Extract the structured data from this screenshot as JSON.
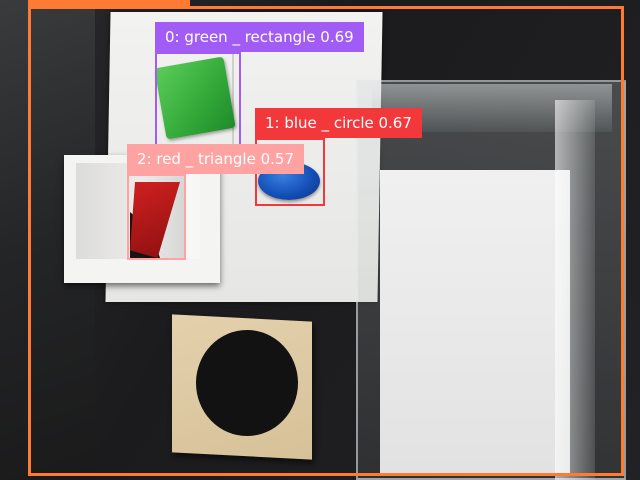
{
  "detections": [
    {
      "id": 0,
      "label_text": "0: green _ rectangle 0.69",
      "color": "#a25cf6",
      "text_color": "#ffffff"
    },
    {
      "id": 1,
      "label_text": "1: blue _ circle 0.67",
      "color": "#f2383b",
      "text_color": "#ffffff"
    },
    {
      "id": 2,
      "label_text": "2: red _ triangle 0.57",
      "color": "#fea3a2",
      "text_color": "#ffffff"
    }
  ],
  "frame_color": "#ff7a33"
}
